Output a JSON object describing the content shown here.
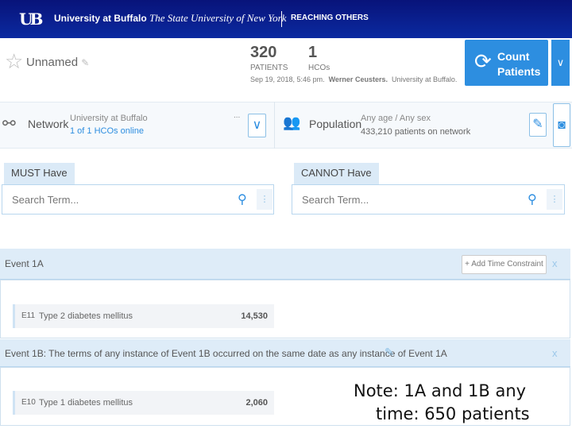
{
  "header": {
    "logo": "UB",
    "university": "University at Buffalo",
    "state": "The State University of New York",
    "tagline": "REACHING OTHERS"
  },
  "query": {
    "name": "Unnamed",
    "patients": "320",
    "patients_label": "PATIENTS",
    "hcos": "1",
    "hcos_label": "HCOs",
    "meta_date": "Sep 19, 2018, 5:46 pm.",
    "meta_user": "Werner Ceusters.",
    "meta_org": "University at Buffalo.",
    "count_label_1": "Count",
    "count_label_2": "Patients"
  },
  "network": {
    "label": "Network",
    "org": "University at Buffalo",
    "status": "1 of 1 HCOs online",
    "more": "..."
  },
  "population": {
    "label": "Population",
    "criteria": "Any age / Any sex",
    "count": "433,210 patients on network"
  },
  "must": {
    "tab": "MUST Have",
    "placeholder": "Search Term..."
  },
  "cannot": {
    "tab": "CANNOT Have",
    "placeholder": "Search Term..."
  },
  "events": [
    {
      "title": "Event 1A",
      "add_constraint": "+ Add Time Constraint",
      "close": "x",
      "code": "E11",
      "term": "Type 2 diabetes mellitus",
      "count": "14,530"
    },
    {
      "title": "Event 1B: The terms of any instance of Event 1B occurred on the same date as any instance of Event 1A",
      "close": "x",
      "code": "E10",
      "term": "Type 1 diabetes mellitus",
      "count": "2,060"
    }
  ],
  "note": {
    "line1": "Note: 1A and 1B any",
    "line2": "time: 650 patients"
  }
}
